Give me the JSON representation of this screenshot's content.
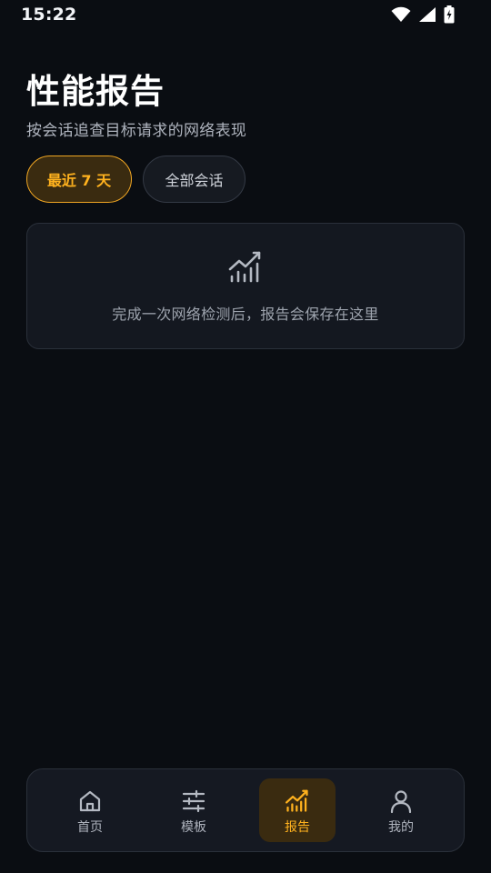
{
  "status_bar": {
    "time": "15:22"
  },
  "header": {
    "title": "性能报告",
    "subtitle": "按会话追查目标请求的网络表现"
  },
  "filters": {
    "chips": [
      {
        "label": "最近 7 天",
        "selected": true
      },
      {
        "label": "全部会话",
        "selected": false
      }
    ]
  },
  "empty_state": {
    "message": "完成一次网络检测后，报告会保存在这里",
    "icon": "chart-trend-icon"
  },
  "bottom_nav": {
    "items": [
      {
        "label": "首页",
        "icon": "home-icon",
        "active": false
      },
      {
        "label": "模板",
        "icon": "sliders-icon",
        "active": false
      },
      {
        "label": "报告",
        "icon": "chart-trend-icon",
        "active": true
      },
      {
        "label": "我的",
        "icon": "user-icon",
        "active": false
      }
    ]
  },
  "colors": {
    "background": "#0a0d12",
    "accent": "#ffb21e",
    "accent_bg": "#3a2b10",
    "card_bg": "#141820",
    "muted_text": "#9ea4ae"
  }
}
